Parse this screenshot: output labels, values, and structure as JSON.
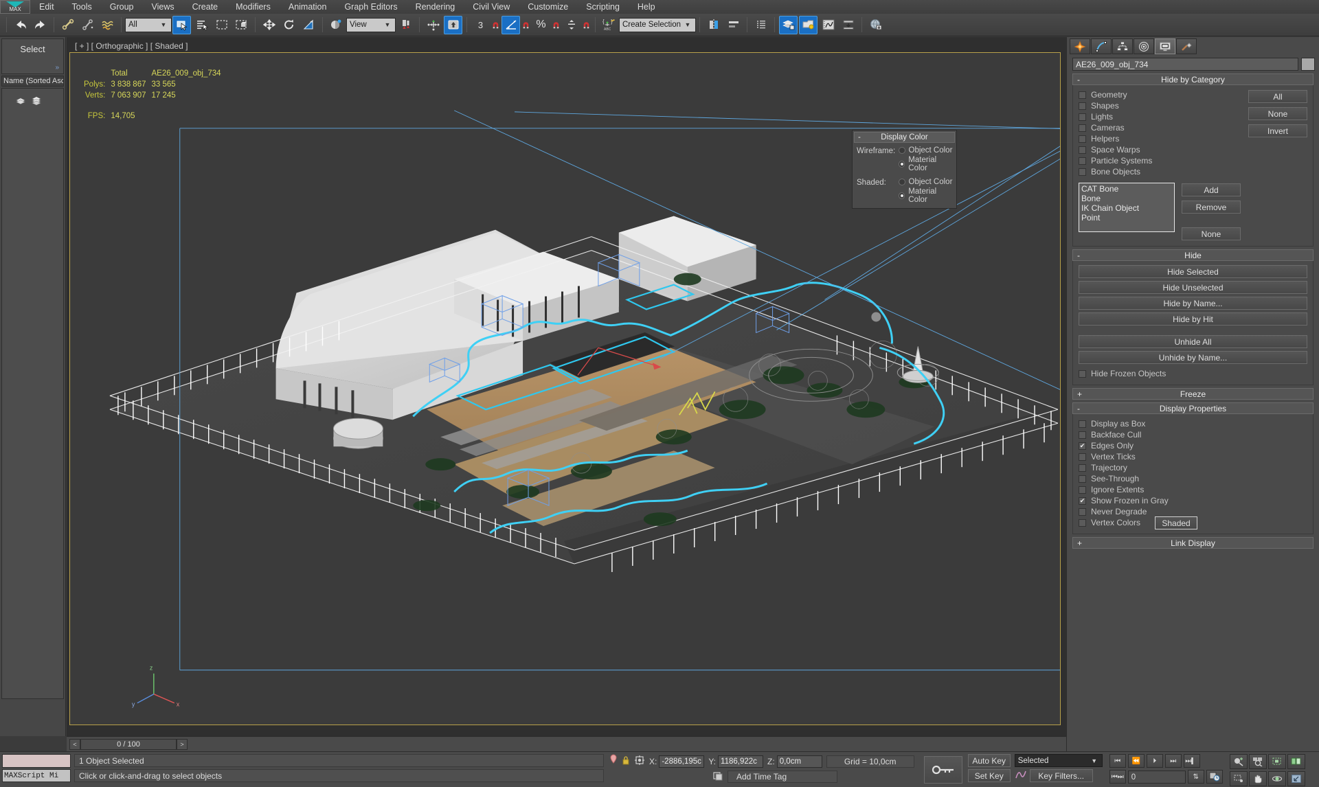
{
  "app": {
    "logo_text": "MAX"
  },
  "menu": {
    "items": [
      "Edit",
      "Tools",
      "Group",
      "Views",
      "Create",
      "Modifiers",
      "Animation",
      "Graph Editors",
      "Rendering",
      "Civil View",
      "Customize",
      "Scripting",
      "Help"
    ]
  },
  "toolbar": {
    "filter_value": "All",
    "reference_coord_value": "View",
    "selection_set_value": "Create Selection Se",
    "snap_percent_label": "3",
    "icons": [
      "undo-icon",
      "redo-icon",
      "link-icon",
      "unlink-icon",
      "bind-space-warp-icon",
      "selection-filter-combo",
      "select-object-icon",
      "select-by-name-icon",
      "select-region-icon",
      "window-crossing-icon",
      "select-move-icon",
      "select-rotate-icon",
      "select-scale-icon",
      "reference-coordinate-icon",
      "use-center-icon",
      "select-manipulate-icon",
      "snap-toggle-icon",
      "angle-snap-icon",
      "percent-snap-icon",
      "spinner-snap-icon",
      "named-selection-icon",
      "mirror-icon",
      "align-icon",
      "layer-manager-icon",
      "curve-editor-icon",
      "schematic-view-icon",
      "material-editor-icon",
      "render-setup-icon",
      "render-frame-icon",
      "render-production-icon"
    ]
  },
  "left_panel": {
    "title": "Select",
    "sort_label": "Name (Sorted Asc",
    "chevron": "»"
  },
  "viewport": {
    "label": "[ + ] [ Orthographic ] [ Shaded ]",
    "stats": {
      "col_total": "Total",
      "col_object": "AE26_009_obj_734",
      "rows": [
        {
          "label": "Polys:",
          "total": "3 838 867",
          "object": "33 565"
        },
        {
          "label": "Verts:",
          "total": "7 063 907",
          "object": "17 245"
        }
      ],
      "fps_label": "FPS:",
      "fps_value": "14,705"
    },
    "display_color": {
      "title": "Display Color",
      "minus": "-",
      "wireframe_label": "Wireframe:",
      "shaded_label": "Shaded:",
      "option_object": "Object Color",
      "option_material": "Material Color",
      "wireframe_selected": "Material Color",
      "shaded_selected": "Material Color"
    }
  },
  "trackbar": {
    "prev": "<",
    "frame": "0 / 100",
    "next": ">"
  },
  "command_panel": {
    "tabs": [
      "create-tab",
      "modify-tab",
      "hierarchy-tab",
      "motion-tab",
      "display-tab",
      "utilities-tab"
    ],
    "active_tab": "display-tab",
    "object_name": "AE26_009_obj_734",
    "rollups": {
      "hide_by_category": {
        "title": "Hide by Category",
        "minus": "-",
        "categories": [
          {
            "label": "Geometry",
            "checked": false
          },
          {
            "label": "Shapes",
            "checked": false
          },
          {
            "label": "Lights",
            "checked": false
          },
          {
            "label": "Cameras",
            "checked": false
          },
          {
            "label": "Helpers",
            "checked": false
          },
          {
            "label": "Space Warps",
            "checked": false
          },
          {
            "label": "Particle Systems",
            "checked": false
          },
          {
            "label": "Bone Objects",
            "checked": false
          }
        ],
        "buttons": [
          "All",
          "None",
          "Invert"
        ],
        "list_items": [
          "CAT Bone",
          "Bone",
          "IK Chain Object",
          "Point"
        ],
        "side_buttons": [
          "Add",
          "Remove",
          "None"
        ]
      },
      "hide": {
        "title": "Hide",
        "minus": "-",
        "buttons": [
          "Hide Selected",
          "Hide Unselected",
          "Hide by Name...",
          "Hide by Hit"
        ],
        "buttons2": [
          "Unhide All",
          "Unhide by Name..."
        ],
        "checkbox": {
          "label": "Hide Frozen Objects",
          "checked": false
        }
      },
      "freeze": {
        "title": "Freeze",
        "plus": "+"
      },
      "display_properties": {
        "title": "Display Properties",
        "minus": "-",
        "items": [
          {
            "label": "Display as Box",
            "checked": false
          },
          {
            "label": "Backface Cull",
            "checked": false
          },
          {
            "label": "Edges Only",
            "checked": true
          },
          {
            "label": "Vertex Ticks",
            "checked": false
          },
          {
            "label": "Trajectory",
            "checked": false
          },
          {
            "label": "See-Through",
            "checked": false
          },
          {
            "label": "Ignore Extents",
            "checked": false
          },
          {
            "label": "Show Frozen in Gray",
            "checked": true
          },
          {
            "label": "Never Degrade",
            "checked": false
          },
          {
            "label": "Vertex Colors",
            "checked": false
          }
        ],
        "shaded_button": "Shaded"
      },
      "link_display": {
        "title": "Link Display",
        "plus": "+"
      }
    }
  },
  "status_bar": {
    "maxscript_label": "MAXScript Mi",
    "selection_status": "1 Object Selected",
    "prompt": "Click or click-and-drag to select objects",
    "coords": {
      "x_label": "X:",
      "x_value": "-2886,195c",
      "y_label": "Y:",
      "y_value": "1186,922c",
      "z_label": "Z:",
      "z_value": "0,0cm"
    },
    "grid_label": "Grid = 10,0cm",
    "add_time_tag": "Add Time Tag",
    "auto_key": "Auto Key",
    "set_key": "Set Key",
    "key_mode_value": "Selected",
    "key_filters": "Key Filters...",
    "frame_field": "0",
    "icons": [
      "pin-icon",
      "lock-selection-icon",
      "absolute-mode-icon",
      "key-toggle-icon",
      "isolate-icon"
    ]
  },
  "colors": {
    "accent_blue": "#1a6fc4",
    "viewport_border": "#b9a14a",
    "stats_yellow": "#c8c83c",
    "selection_cyan": "#35c8f0",
    "panel_bg": "#4a4a4a"
  }
}
